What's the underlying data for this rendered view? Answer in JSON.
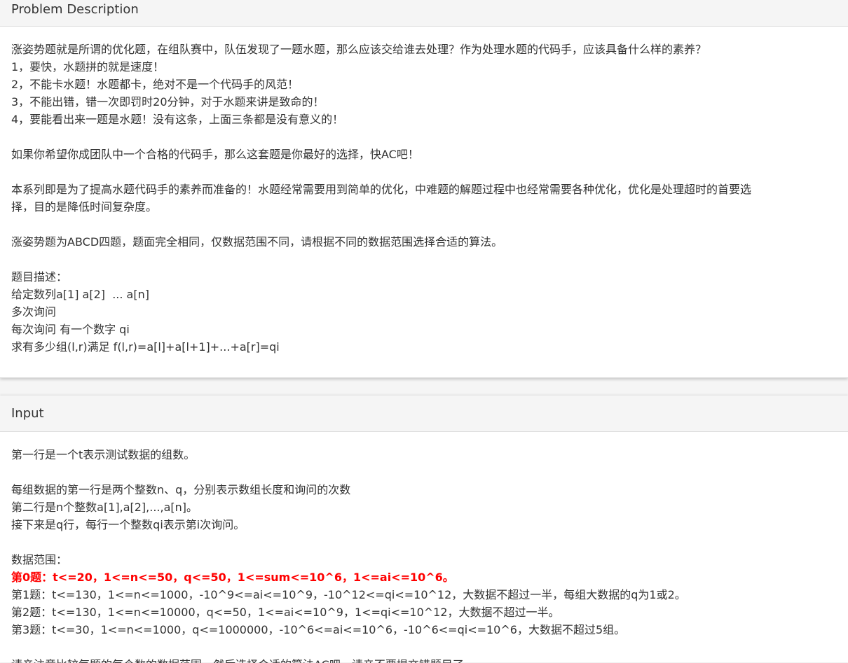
{
  "problem": {
    "heading": "Problem Description",
    "lines": [
      "涨姿势题就是所谓的优化题，在组队赛中，队伍发现了一题水题，那么应该交给谁去处理？作为处理水题的代码手，应该具备什么样的素养？",
      "1，要快，水题拼的就是速度！",
      "2，不能卡水题！水题都卡，绝对不是一个代码手的风范！",
      "3，不能出错，错一次即罚时20分钟，对于水题来讲是致命的！",
      "4，要能看出来一题是水题！没有这条，上面三条都是没有意义的！",
      "",
      "如果你希望你成团队中一个合格的代码手，那么这套题是你最好的选择，快AC吧！",
      "",
      "本系列即是为了提高水题代码手的素养而准备的！水题经常需要用到简单的优化，中难题的解题过程中也经常需要各种优化，优化是处理超时的首要选",
      "择，目的是降低时间复杂度。",
      "",
      "涨姿势题为ABCD四题，题面完全相同，仅数据范围不同，请根据不同的数据范围选择合适的算法。",
      "",
      "题目描述：",
      "给定数列a[1] a[2]  ... a[n]",
      "多次询问",
      "每次询问 有一个数字 qi",
      "求有多少组(l,r)满足 f(l,r)=a[l]+a[l+1]+...+a[r]=qi"
    ]
  },
  "input": {
    "heading": "Input",
    "lines": [
      "第一行是一个t表示测试数据的组数。",
      "",
      "每组数据的第一行是两个整数n、q，分别表示数组长度和询问的次数",
      "第二行是n个整数a[1],a[2],...,a[n]。",
      "接下来是q行，每行一个整数qi表示第i次询问。",
      "",
      "数据范围："
    ],
    "highlight": "第0题：t<=20，1<=n<=50，q<=50，1<=sum<=10^6，1<=ai<=10^6。",
    "ranges": [
      "第1题：t<=130，1<=n<=1000，-10^9<=ai<=10^9，-10^12<=qi<=10^12，大数据不超过一半，每组大数据的q为1或2。",
      "第2题：t<=130，1<=n<=10000，q<=50，1<=ai<=10^9，1<=qi<=10^12，大数据不超过一半。",
      "第3题：t<=30，1<=n<=1000，q<=1000000，-10^6<=ai<=10^6，-10^6<=qi<=10^6，大数据不超过5组。"
    ],
    "cut_line": "请亲注意比较每题的每个数的数据范围，然后选择合适的算法AC吧，请亲不要提交错题目了。"
  },
  "colors": {
    "highlight": "#ff0000",
    "heading_bg": "#f5f5f5",
    "border": "#dddddd"
  }
}
